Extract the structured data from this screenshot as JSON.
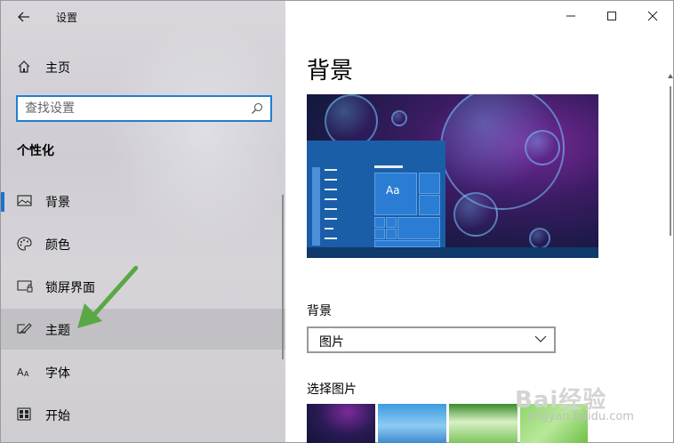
{
  "window": {
    "title": "设置",
    "back_icon": "back-arrow-icon",
    "minimize_icon": "minimize-icon",
    "maximize_icon": "maximize-icon",
    "close_icon": "close-icon"
  },
  "sidebar": {
    "home_label": "主页",
    "search": {
      "placeholder": "查找设置",
      "icon": "search-icon"
    },
    "section_title": "个性化",
    "items": [
      {
        "label": "背景",
        "icon": "image-icon",
        "selected": true
      },
      {
        "label": "颜色",
        "icon": "palette-icon",
        "selected": false
      },
      {
        "label": "锁屏界面",
        "icon": "lock-screen-icon",
        "selected": false
      },
      {
        "label": "主题",
        "icon": "theme-brush-icon",
        "selected": false,
        "hover": true
      },
      {
        "label": "字体",
        "icon": "font-icon",
        "selected": false
      },
      {
        "label": "开始",
        "icon": "start-menu-icon",
        "selected": false
      }
    ],
    "preview_tile_text": "Aa"
  },
  "main": {
    "page_title": "背景",
    "background_label": "背景",
    "background_dropdown_value": "图片",
    "choose_picture_label": "选择图片"
  },
  "watermark": {
    "line1": "Bai经验",
    "line2": "jingyan.baidu.com"
  },
  "colors": {
    "accent": "#1a73c9",
    "arrow": "#5aa845"
  }
}
